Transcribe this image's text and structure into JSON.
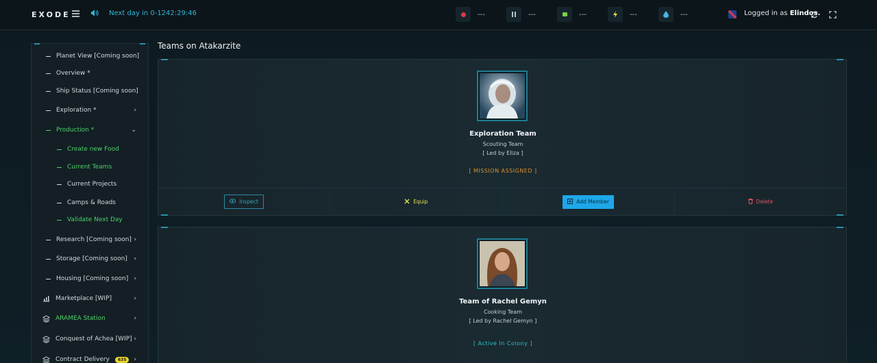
{
  "header": {
    "logo": "EXODE",
    "next_day": "Next day in 0-1242:29:46",
    "resources": [
      {
        "icon": "red-circle-icon",
        "value": "---",
        "color": "#e0354b"
      },
      {
        "icon": "pickaxe-icon",
        "value": "---",
        "color": "#b9c6cb"
      },
      {
        "icon": "food-icon",
        "value": "---",
        "color": "#7bd046"
      },
      {
        "icon": "lightning-icon",
        "value": "---",
        "color": "#e6e34d"
      },
      {
        "icon": "water-drop-icon",
        "value": "---",
        "color": "#49b4e6"
      }
    ],
    "logged_prefix": "Logged in as ",
    "username": "Elindos."
  },
  "sidebar": {
    "items": [
      {
        "label": "Planet View [Coming soon]"
      },
      {
        "label": "Overview *"
      },
      {
        "label": "Ship Status [Coming soon]"
      },
      {
        "label": "Exploration *"
      },
      {
        "label": "Production *"
      },
      {
        "label": "Create new Food"
      },
      {
        "label": "Current Teams"
      },
      {
        "label": "Current Projects"
      },
      {
        "label": "Camps & Roads"
      },
      {
        "label": "Validate Next Day"
      },
      {
        "label": "Research [Coming soon]"
      },
      {
        "label": "Storage [Coming soon]"
      },
      {
        "label": "Housing [Coming soon]"
      },
      {
        "label": "Marketplace [WIP]"
      },
      {
        "label": "ARAMEA Station"
      },
      {
        "label": "Conquest of Achea [WIP]"
      },
      {
        "label": "Contract Delivery",
        "badge": "635"
      }
    ]
  },
  "main": {
    "title": "Teams on Atakarzite",
    "teams": [
      {
        "name": "Exploration Team",
        "type": "Scouting Team",
        "leader": "[ Led by Eliza ]",
        "status": "[ MISSION ASSIGNED ]",
        "status_color": "#d9912c"
      },
      {
        "name": "Team of Rachel Gemyn",
        "type": "Cooking Team",
        "leader": "[ Led by Rachel Gemyn ]",
        "status": "[ Active In Colony ]",
        "status_color": "#2fc3c9"
      }
    ],
    "actions": {
      "inspect": "Inspect",
      "equip": "Equip",
      "add_member": "Add Member",
      "delete": "Delete"
    }
  }
}
